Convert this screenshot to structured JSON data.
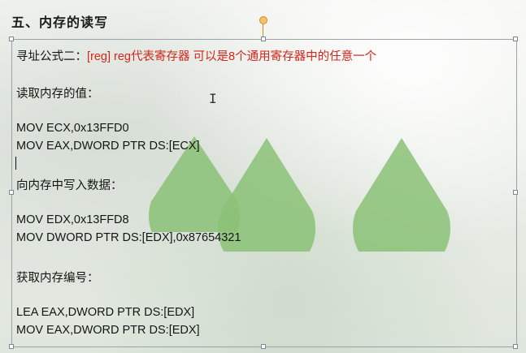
{
  "slide": {
    "title": "五、内存的读写",
    "formula": {
      "label": "寻址公式二：",
      "highlight": "[reg]  reg代表寄存器 可以是8个通用寄存器中的任意一个"
    },
    "read_heading": "读取内存的值：",
    "read_lines": [
      "MOV ECX,0x13FFD0",
      "MOV EAX,DWORD PTR DS:[ECX]"
    ],
    "write_heading": "向内存中写入数据：",
    "write_lines": [
      "MOV EDX,0x13FFD8",
      "MOV DWORD PTR DS:[EDX],0x87654321"
    ],
    "lea_heading": "获取内存编号：",
    "lea_lines": [
      "LEA  EAX,DWORD PTR DS:[EDX]",
      "MOV EAX,DWORD PTR DS:[EDX]"
    ]
  },
  "colors": {
    "highlight_text": "#d4261c",
    "drop_green": "#8bc277",
    "handle_orange": "#f2c26e"
  },
  "cursor": {
    "type": "i-beam",
    "glyph": "I"
  }
}
